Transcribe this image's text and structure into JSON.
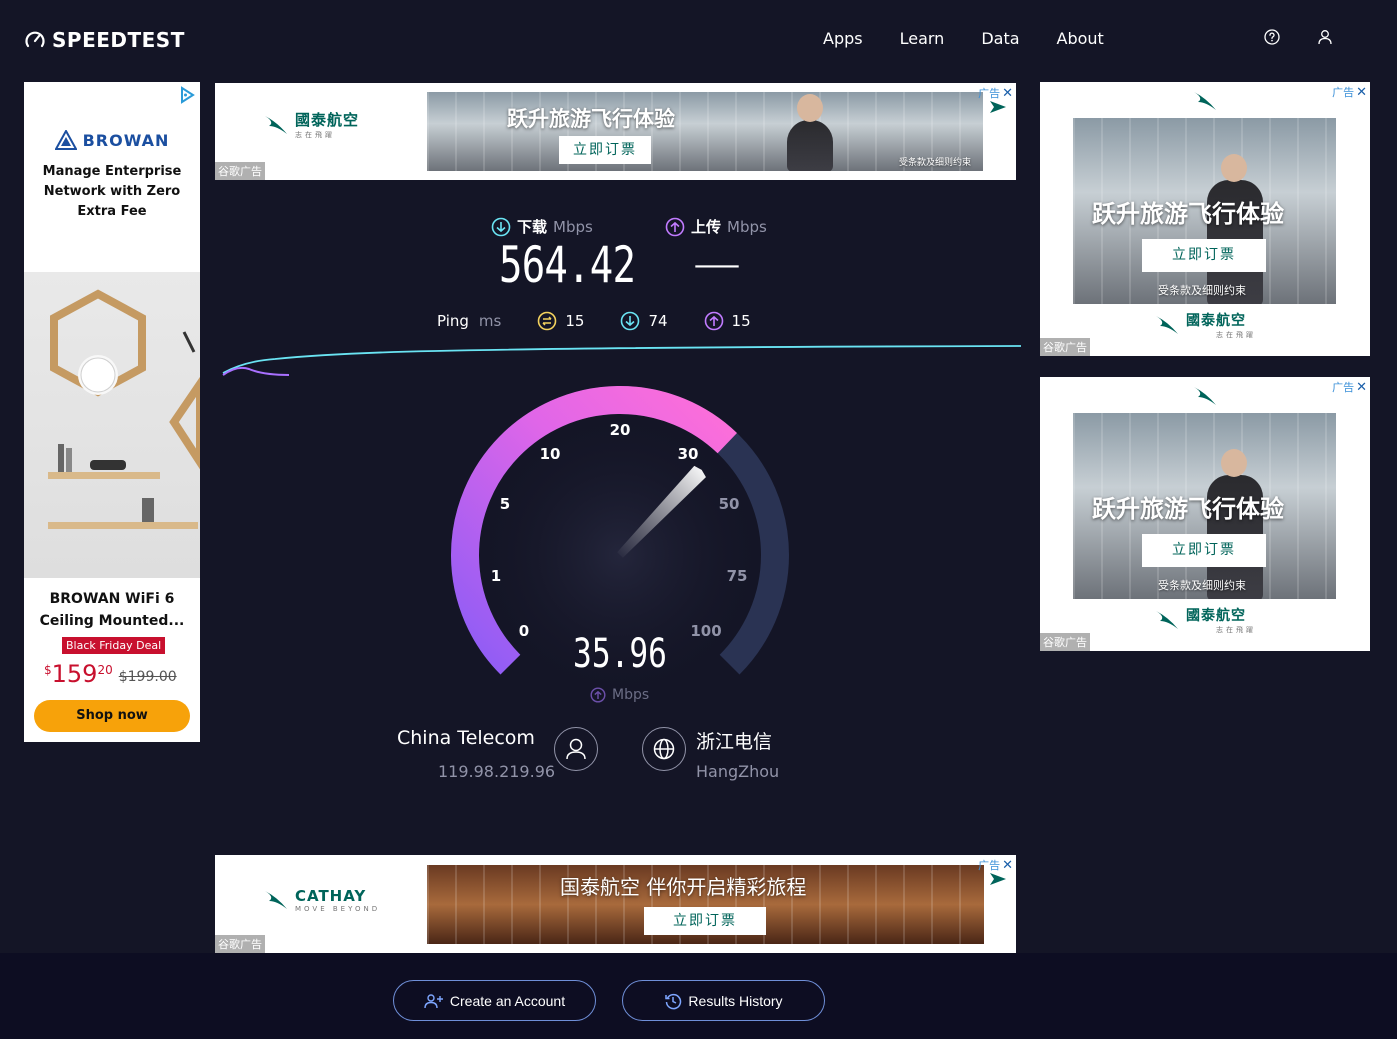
{
  "header": {
    "logo": "SPEEDTEST",
    "nav": [
      "Apps",
      "Learn",
      "Data",
      "About"
    ],
    "help_icon": "help-circle-icon",
    "user_icon": "user-icon"
  },
  "ads": {
    "label": "谷歌广告",
    "close_text": "广告",
    "cathay": {
      "brand_cn": "國泰航空",
      "brand_tag": "志在飛躍",
      "headline": "跃升旅游飞行体验",
      "cta": "立即订票",
      "note": "受条款及细则约束"
    },
    "bottom": {
      "brand_en": "CATHAY",
      "brand_tag": "MOVE BEYOND",
      "headline": "国泰航空 伴你开启精彩旅程",
      "cta": "立即订票"
    },
    "browan": {
      "brand": "BROWAN",
      "headline": "Manage Enterprise Network with Zero Extra Fee",
      "product": "BROWAN WiFi 6 Ceiling Mounted...",
      "deal": "Black Friday Deal",
      "price_currency": "$",
      "price_main": "159",
      "price_cents": "20",
      "price_old": "$199.00",
      "cta": "Shop now"
    }
  },
  "result": {
    "download_label": "下载",
    "upload_label": "上传",
    "unit": "Mbps",
    "download_value": "564.42",
    "upload_value": "—",
    "ping_label": "Ping",
    "ping_unit": "ms",
    "ping_idle": "15",
    "ping_download": "74",
    "ping_upload": "15"
  },
  "gauge": {
    "ticks": [
      "0",
      "1",
      "5",
      "10",
      "20",
      "30",
      "50",
      "75",
      "100"
    ],
    "value": "35.96",
    "unit": "Mbps",
    "current_mbps": 35.96,
    "accent_start": "#8b5cf6",
    "accent_end": "#ff6fd8"
  },
  "connection": {
    "isp": "China Telecom",
    "ip": "119.98.219.96",
    "server": "浙江电信",
    "city": "HangZhou"
  },
  "footer": {
    "create_account": "Create an Account",
    "results_history": "Results History"
  }
}
